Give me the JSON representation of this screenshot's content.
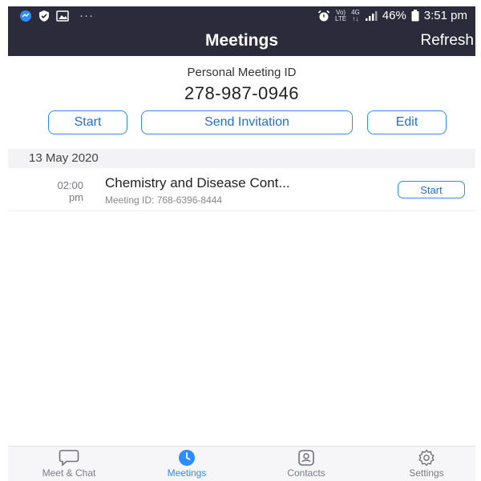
{
  "status_bar": {
    "dots": "···",
    "carrier_top": "Vo)",
    "carrier_bottom": "LTE",
    "net_top": "4G",
    "net_bottom": "↑↓",
    "battery": "46%",
    "time": "3:51 pm"
  },
  "header": {
    "title": "Meetings",
    "refresh_label": "Refresh"
  },
  "personal_meeting": {
    "label": "Personal Meeting ID",
    "id": "278-987-0946",
    "start_label": "Start",
    "invite_label": "Send Invitation",
    "edit_label": "Edit"
  },
  "schedule": {
    "date": "13 May 2020",
    "meetings": [
      {
        "time": "02:00",
        "ampm": "pm",
        "title": "Chemistry and Disease Cont...",
        "meeting_id": "Meeting ID: 768-6396-8444",
        "start_label": "Start"
      }
    ]
  },
  "tabs": [
    {
      "label": "Meet & Chat",
      "icon": "chat-bubble-icon"
    },
    {
      "label": "Meetings",
      "icon": "clock-icon"
    },
    {
      "label": "Contacts",
      "icon": "contact-card-icon"
    },
    {
      "label": "Settings",
      "icon": "gear-icon"
    }
  ],
  "colors": {
    "header_bg": "#2c2b3b",
    "accent": "#2d8cff"
  }
}
